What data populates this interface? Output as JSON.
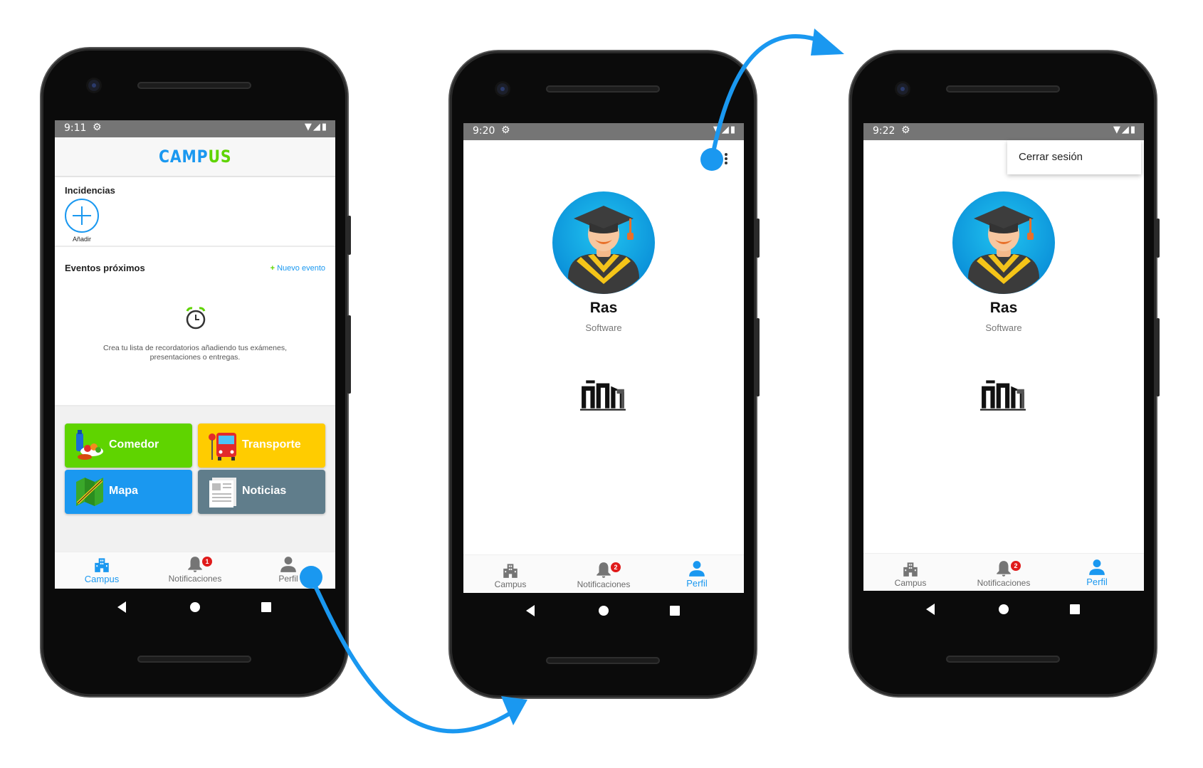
{
  "colors": {
    "accent": "#1a98f0",
    "comedor": "#5fd400",
    "transporte": "#ffcc00",
    "mapa": "#1a98f0",
    "noticias": "#607d8b",
    "arrow": "#1a98f0",
    "badge": "#e01b1b"
  },
  "screen1": {
    "status_time": "9:11",
    "brand": {
      "camp": "CAMP",
      "us": "US"
    },
    "incidencias": {
      "title": "Incidencias",
      "add_label": "Añadir"
    },
    "eventos": {
      "title": "Eventos próximos",
      "new_event": "Nuevo evento",
      "empty_text_1": "Crea tu lista de recordatorios añadiendo tus exámenes,",
      "empty_text_2": "presentaciones o entregas."
    },
    "tiles": [
      {
        "label": "Comedor",
        "icon": "food-icon"
      },
      {
        "label": "Transporte",
        "icon": "bus-icon"
      },
      {
        "label": "Mapa",
        "icon": "map-icon"
      },
      {
        "label": "Noticias",
        "icon": "newspaper-icon"
      }
    ],
    "bottom_nav": [
      {
        "label": "Campus",
        "icon": "building-icon",
        "active": true
      },
      {
        "label": "Notificaciones",
        "icon": "bell-icon",
        "badge": "1"
      },
      {
        "label": "Perfil",
        "icon": "person-icon"
      }
    ]
  },
  "screen2": {
    "status_time": "9:20",
    "profile": {
      "name": "Ras",
      "subtitle": "Software",
      "avatar": "graduate-avatar-icon",
      "logo": "university-logo-icon"
    },
    "bottom_nav": [
      {
        "label": "Campus",
        "icon": "building-icon"
      },
      {
        "label": "Notificaciones",
        "icon": "bell-icon",
        "badge": "2"
      },
      {
        "label": "Perfil",
        "icon": "person-icon",
        "active": true
      }
    ]
  },
  "screen3": {
    "status_time": "9:22",
    "menu": {
      "logout": "Cerrar sesión"
    },
    "profile": {
      "name": "Ras",
      "subtitle": "Software",
      "avatar": "graduate-avatar-icon",
      "logo": "university-logo-icon"
    },
    "bottom_nav": [
      {
        "label": "Campus",
        "icon": "building-icon"
      },
      {
        "label": "Notificaciones",
        "icon": "bell-icon",
        "badge": "2"
      },
      {
        "label": "Perfil",
        "icon": "person-icon",
        "active": true
      }
    ]
  }
}
